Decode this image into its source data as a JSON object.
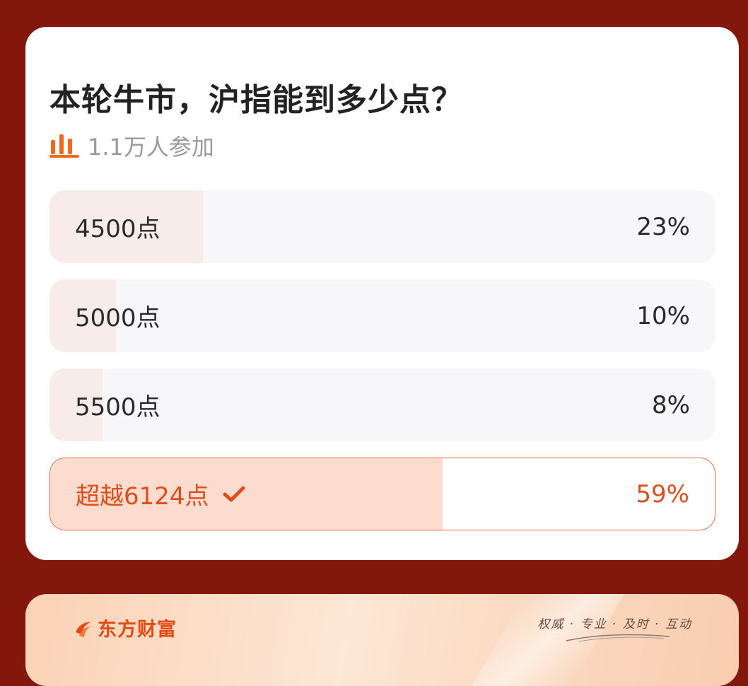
{
  "poll": {
    "title": "本轮牛市，沪指能到多少点？",
    "participants": "1.1万人参加",
    "options": [
      {
        "label": "4500点",
        "percent_text": "23%",
        "percent": 23,
        "selected": false
      },
      {
        "label": "5000点",
        "percent_text": "10%",
        "percent": 10,
        "selected": false
      },
      {
        "label": "5500点",
        "percent_text": "8%",
        "percent": 8,
        "selected": false
      },
      {
        "label": "超越6124点",
        "percent_text": "59%",
        "percent": 59,
        "selected": true
      }
    ],
    "icons": {
      "participants": "bar-chart-icon",
      "selected": "checkmark-icon"
    }
  },
  "banner": {
    "brand": "东方财富",
    "slogan": "权威 · 专业 · 及时 · 互动",
    "icons": {
      "logo": "flame-logo-icon"
    }
  },
  "colors": {
    "background": "#83170c",
    "accent": "#df4e1a",
    "selected_fill": "#fddcd0",
    "unselected_fill": "#f7ecea",
    "track": "#f7f7f9"
  }
}
